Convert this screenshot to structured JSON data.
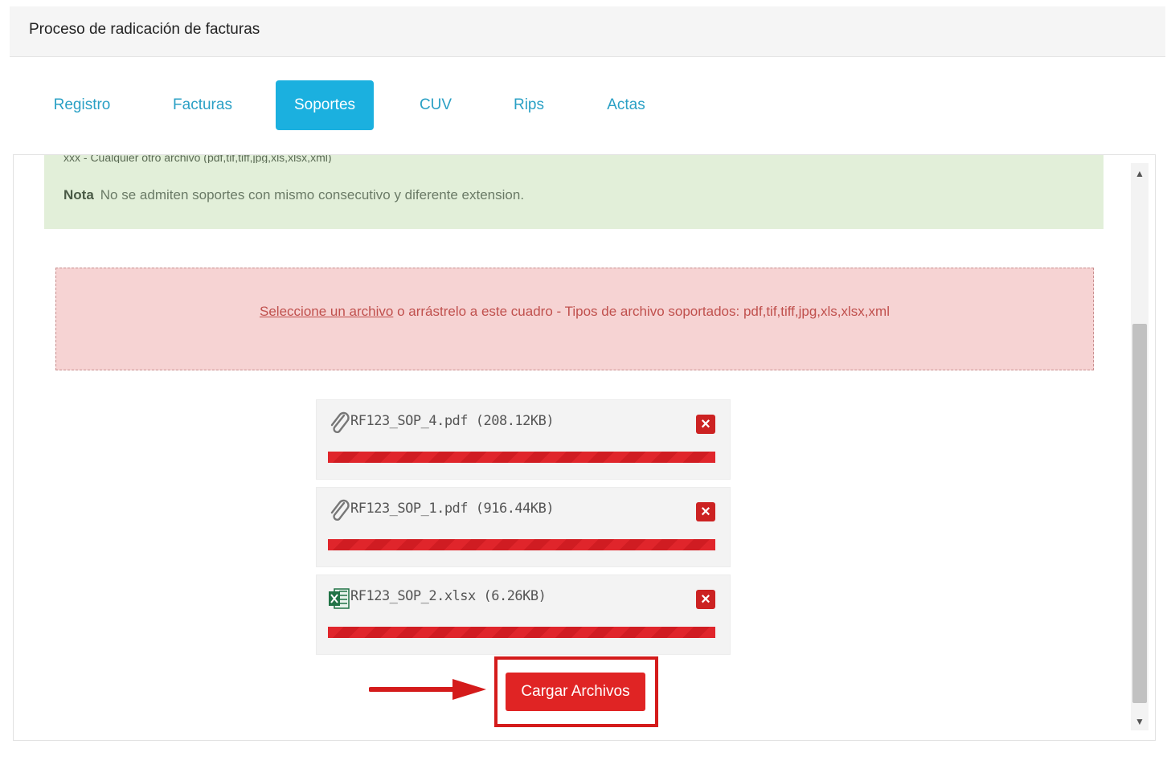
{
  "panel": {
    "title": "Proceso de radicación de facturas"
  },
  "tabs": [
    {
      "label": "Registro"
    },
    {
      "label": "Facturas"
    },
    {
      "label": "Soportes",
      "active": true
    },
    {
      "label": "CUV"
    },
    {
      "label": "Rips"
    },
    {
      "label": "Actas"
    }
  ],
  "note": {
    "cut_line": "xxx - Cualquier otro archivo (pdf,tif,tiff,jpg,xls,xlsx,xml)",
    "label": "Nota",
    "text": "No se admiten soportes con mismo consecutivo y diferente extension."
  },
  "dropzone": {
    "link_text": "Seleccione un archivo",
    "text": " o arrástrelo a este cuadro - Tipos de archivo soportados: pdf,tif,tiff,jpg,xls,xlsx,xml"
  },
  "files": [
    {
      "name": "RF123_SOP_4.pdf (208.12KB)",
      "icon": "paperclip-icon",
      "progress": 1.0
    },
    {
      "name": "RF123_SOP_1.pdf (916.44KB)",
      "icon": "paperclip-icon",
      "progress": 1.0
    },
    {
      "name": "RF123_SOP_2.xlsx (6.26KB)",
      "icon": "excel-icon",
      "progress": 1.0
    }
  ],
  "upload": {
    "label": "Cargar Archivos"
  },
  "colors": {
    "tab_active": "#1bb0df",
    "tab_text": "#2aa0c5",
    "note_bg": "#e2efd9",
    "dropzone_bg": "#f6d3d3",
    "progress": "#e0252b",
    "highlight": "#d41b1b"
  }
}
